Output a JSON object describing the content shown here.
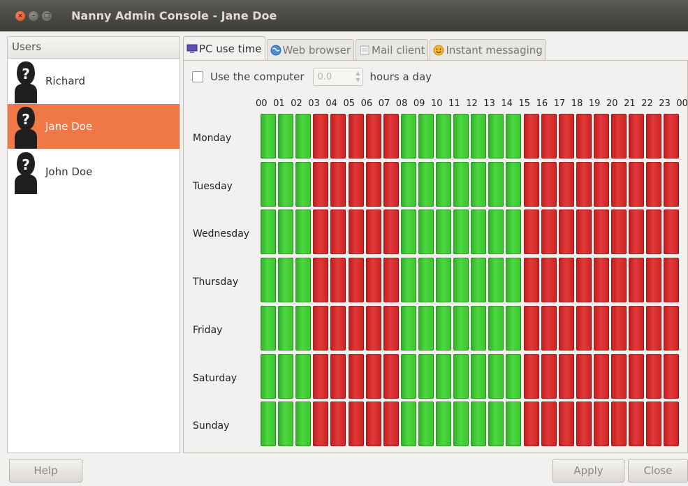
{
  "window": {
    "title": "Nanny Admin Console - Jane Doe"
  },
  "users": {
    "header": "Users",
    "items": [
      {
        "name": "Richard",
        "selected": false
      },
      {
        "name": "Jane Doe",
        "selected": true
      },
      {
        "name": "John Doe",
        "selected": false
      }
    ]
  },
  "tabs": [
    {
      "label": "PC use time",
      "icon": "monitor-icon",
      "active": true
    },
    {
      "label": "Web browser",
      "icon": "globe-icon",
      "active": false
    },
    {
      "label": "Mail client",
      "icon": "mail-icon",
      "active": false
    },
    {
      "label": "Instant messaging",
      "icon": "smiley-icon",
      "active": false
    }
  ],
  "pc_use": {
    "checkbox_label": "Use the computer",
    "checked": false,
    "hours_value": "0.0",
    "hours_suffix": "hours a day"
  },
  "schedule": {
    "hours": [
      "00",
      "01",
      "02",
      "03",
      "04",
      "05",
      "06",
      "07",
      "08",
      "09",
      "10",
      "11",
      "12",
      "13",
      "14",
      "15",
      "16",
      "17",
      "18",
      "19",
      "20",
      "21",
      "22",
      "23",
      "00"
    ],
    "days": [
      "Monday",
      "Tuesday",
      "Wednesday",
      "Thursday",
      "Friday",
      "Saturday",
      "Sunday"
    ],
    "allowed_pattern": [
      1,
      1,
      1,
      0,
      0,
      0,
      0,
      0,
      1,
      1,
      1,
      1,
      1,
      1,
      1,
      0,
      0,
      0,
      0,
      0,
      0,
      0,
      0,
      0
    ],
    "colors": {
      "allowed": "#3fc935",
      "blocked": "#d92b2b"
    }
  },
  "buttons": {
    "help": "Help",
    "apply": "Apply",
    "close": "Close"
  }
}
